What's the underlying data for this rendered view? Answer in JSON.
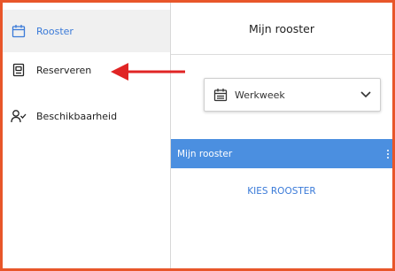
{
  "sidebar": {
    "items": [
      {
        "label": "Rooster",
        "icon": "calendar-icon",
        "active": true
      },
      {
        "label": "Reserveren",
        "icon": "reserve-icon",
        "active": false
      },
      {
        "label": "Beschikbaarheid",
        "icon": "person-check-icon",
        "active": false
      }
    ]
  },
  "main": {
    "title": "Mijn rooster",
    "view_select": {
      "value": "Werkweek",
      "icon": "calendar-icon"
    },
    "roster_bar": {
      "label": "Mijn rooster",
      "icon": "more-vertical-icon"
    },
    "choose_link": "KIES ROOSTER"
  },
  "colors": {
    "accent": "#3a7ad8",
    "bar": "#4b8fe0",
    "frame": "#e8562a",
    "arrow": "#e02424"
  }
}
